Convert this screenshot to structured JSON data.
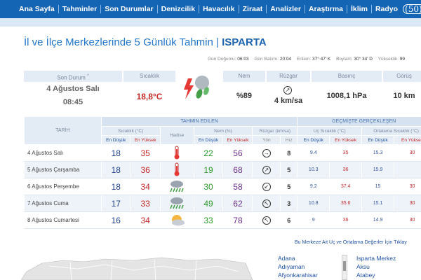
{
  "nav": {
    "items": [
      "Ana Sayfa",
      "Tahminler",
      "Son Durumlar",
      "Denizcilik",
      "Havacılık",
      "Ziraat",
      "Analizler",
      "Araştırma",
      "İklim",
      "Radyo"
    ],
    "logo": "(50)"
  },
  "title": {
    "prefix": "İl ve İlçe Merkezlerinde 5 Günlük Tahmin",
    "sep": "|",
    "city": "ISPARTA"
  },
  "sun": {
    "dogus_label": "Gün Doğumu:",
    "dogus": "06:03",
    "batis_label": "Gün Batımı:",
    "batis": "20:04",
    "enlem_label": "Enlem:",
    "enlem": "37° 47' K",
    "boylam_label": "Boylam:",
    "boylam": "30° 34' D",
    "yukseklik_label": "Yükseklik:",
    "yukseklik": "99"
  },
  "current": {
    "hdr_son": "Son Durum",
    "hdr_sicaklik": "Sıcaklık",
    "hdr_nem": "Nem",
    "hdr_ruzgar": "Rüzgar",
    "hdr_basinc": "Basınç",
    "hdr_gorus": "Görüş",
    "date": "4 Ağustos Salı",
    "time": "08:45",
    "temp": "18,8°C",
    "nem": "%89",
    "ruzgar": "4 km/sa",
    "basinc": "1008,1 hPa",
    "gorus": "10 km"
  },
  "table": {
    "tarih": "TARİH",
    "tahmin": "TAHMİN EDİLEN",
    "gecmis": "GEÇMİŞTE GERÇEKLEŞEN",
    "sicaklik": "Sıcaklık (°C)",
    "hadise": "Hadise",
    "nem": "Nem (%)",
    "ruzgar": "Rüzgar (km/sa)",
    "uc": "Uç Sıcaklık (°C)",
    "ort": "Ortalama Sıcaklık (°C)",
    "en_dusuk": "En Düşük",
    "en_yuksek": "En Yüksek",
    "yon": "Yön",
    "hiz": "Hız",
    "rows": [
      {
        "date": "4 Ağustos Salı",
        "tlo": "18",
        "thi": "35",
        "icon": "hot",
        "nlo": "22",
        "nhi": "56",
        "dir": "→",
        "hiz": "8",
        "ulo": "9.4",
        "uhi": "35",
        "olo": "15.3",
        "ohi": "30"
      },
      {
        "date": "5 Ağustos Çarşamba",
        "tlo": "18",
        "thi": "36",
        "icon": "hot",
        "nlo": "19",
        "nhi": "68",
        "dir": "↗",
        "hiz": "5",
        "ulo": "10.3",
        "uhi": "36",
        "olo": "15.9",
        "ohi": ""
      },
      {
        "date": "6 Ağustos Perşembe",
        "tlo": "18",
        "thi": "34",
        "icon": "rain",
        "nlo": "30",
        "nhi": "58",
        "dir": "↙",
        "hiz": "5",
        "ulo": "9.2",
        "uhi": "37.4",
        "olo": "15",
        "ohi": "30"
      },
      {
        "date": "7 Ağustos Cuma",
        "tlo": "17",
        "thi": "33",
        "icon": "rain",
        "nlo": "49",
        "nhi": "62",
        "dir": "↖",
        "hiz": "3",
        "ulo": "10.8",
        "uhi": "35.6",
        "olo": "15.1",
        "ohi": "30"
      },
      {
        "date": "8 Ağustos Cumartesi",
        "tlo": "16",
        "thi": "34",
        "icon": "partly",
        "nlo": "33",
        "nhi": "78",
        "dir": "↖",
        "hiz": "6",
        "ulo": "9",
        "uhi": "36",
        "olo": "14.9",
        "ohi": "30"
      }
    ]
  },
  "bottom": {
    "note": "Bu Merkeze Ait Uç ve Ortalama Değerler İçin Tıklay",
    "left_list": [
      "Adana",
      "Adıyaman",
      "Afyonkarahisar"
    ],
    "right_list": [
      "Isparta Merkez",
      "Aksu",
      "Atabey"
    ]
  },
  "colors": {
    "nav": "#1565b5",
    "accent": "#2276c9",
    "red": "#c62828",
    "green": "#2e9a2e"
  }
}
